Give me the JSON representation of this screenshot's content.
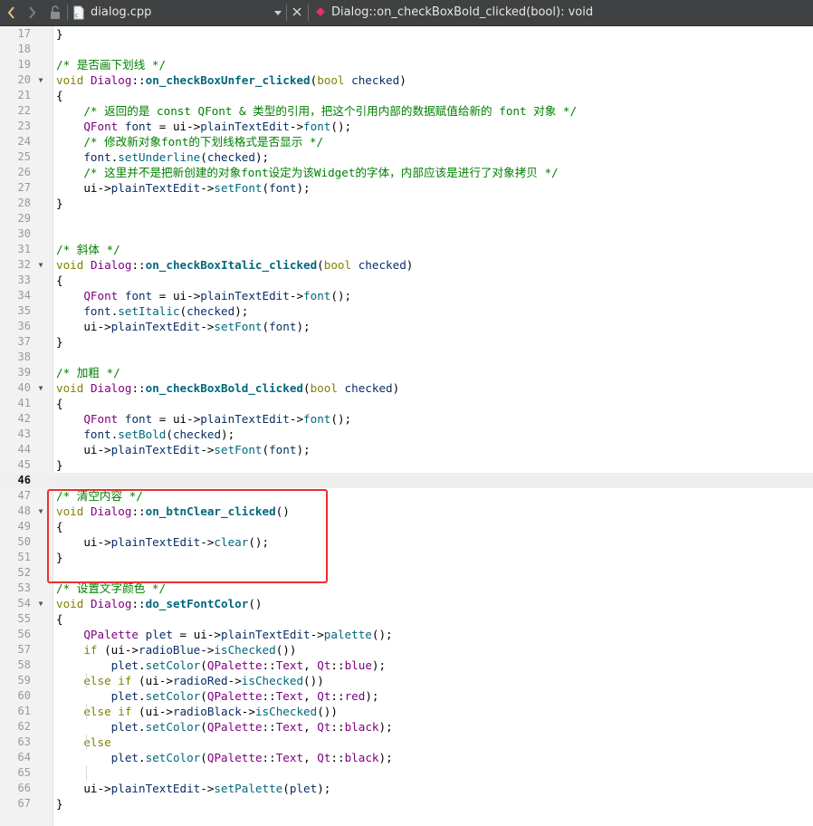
{
  "toolbar": {
    "back_icon": "chevron-left-icon",
    "forward_icon": "chevron-right-icon",
    "lock_icon": "lock-icon",
    "file_icon": "cpp-file-icon",
    "filename": "dialog.cpp",
    "dropdown_icon": "triangle-down-icon",
    "close_icon": "close-icon",
    "symbol_icon": "function-symbol-icon",
    "symbol": "Dialog::on_checkBoxBold_clicked(bool): void",
    "accent_color": "#e5c07b",
    "symbol_icon_color": "#e0316b"
  },
  "editor": {
    "current_line": 46,
    "highlight_color": "#ea2f2f",
    "lines": [
      {
        "n": "17",
        "t": "}",
        "fold": ""
      },
      {
        "n": "18",
        "t": "",
        "fold": ""
      },
      {
        "n": "19",
        "t": "/* 是否画下划线 */",
        "fold": ""
      },
      {
        "n": "20",
        "t": "void Dialog::on_checkBoxUnfer_clicked(bool checked)",
        "fold": "▼"
      },
      {
        "n": "21",
        "t": "{",
        "fold": ""
      },
      {
        "n": "22",
        "t": "    /* 返回的是 const QFont & 类型的引用，把这个引用内部的数据赋值给新的 font 对象 */",
        "fold": ""
      },
      {
        "n": "23",
        "t": "    QFont font = ui->plainTextEdit->font();",
        "fold": ""
      },
      {
        "n": "24",
        "t": "    /* 修改新对象font的下划线格式是否显示 */",
        "fold": ""
      },
      {
        "n": "25",
        "t": "    font.setUnderline(checked);",
        "fold": ""
      },
      {
        "n": "26",
        "t": "    /* 这里并不是把新创建的对象font设定为该Widget的字体，内部应该是进行了对象拷贝 */",
        "fold": ""
      },
      {
        "n": "27",
        "t": "    ui->plainTextEdit->setFont(font);",
        "fold": ""
      },
      {
        "n": "28",
        "t": "}",
        "fold": ""
      },
      {
        "n": "29",
        "t": "",
        "fold": ""
      },
      {
        "n": "30",
        "t": "",
        "fold": ""
      },
      {
        "n": "31",
        "t": "/* 斜体 */",
        "fold": ""
      },
      {
        "n": "32",
        "t": "void Dialog::on_checkBoxItalic_clicked(bool checked)",
        "fold": "▼"
      },
      {
        "n": "33",
        "t": "{",
        "fold": ""
      },
      {
        "n": "34",
        "t": "    QFont font = ui->plainTextEdit->font();",
        "fold": ""
      },
      {
        "n": "35",
        "t": "    font.setItalic(checked);",
        "fold": ""
      },
      {
        "n": "36",
        "t": "    ui->plainTextEdit->setFont(font);",
        "fold": ""
      },
      {
        "n": "37",
        "t": "}",
        "fold": ""
      },
      {
        "n": "38",
        "t": "",
        "fold": ""
      },
      {
        "n": "39",
        "t": "/* 加粗 */",
        "fold": ""
      },
      {
        "n": "40",
        "t": "void Dialog::on_checkBoxBold_clicked(bool checked)",
        "fold": "▼"
      },
      {
        "n": "41",
        "t": "{",
        "fold": ""
      },
      {
        "n": "42",
        "t": "    QFont font = ui->plainTextEdit->font();",
        "fold": ""
      },
      {
        "n": "43",
        "t": "    font.setBold(checked);",
        "fold": ""
      },
      {
        "n": "44",
        "t": "    ui->plainTextEdit->setFont(font);",
        "fold": ""
      },
      {
        "n": "45",
        "t": "}",
        "fold": ""
      },
      {
        "n": "46",
        "t": "",
        "fold": ""
      },
      {
        "n": "47",
        "t": "/* 清空内容 */",
        "fold": ""
      },
      {
        "n": "48",
        "t": "void Dialog::on_btnClear_clicked()",
        "fold": "▼"
      },
      {
        "n": "49",
        "t": "{",
        "fold": ""
      },
      {
        "n": "50",
        "t": "    ui->plainTextEdit->clear();",
        "fold": ""
      },
      {
        "n": "51",
        "t": "}",
        "fold": ""
      },
      {
        "n": "52",
        "t": "",
        "fold": ""
      },
      {
        "n": "53",
        "t": "/* 设置文字颜色 */",
        "fold": ""
      },
      {
        "n": "54",
        "t": "void Dialog::do_setFontColor()",
        "fold": "▼"
      },
      {
        "n": "55",
        "t": "{",
        "fold": ""
      },
      {
        "n": "56",
        "t": "    QPalette plet = ui->plainTextEdit->palette();",
        "fold": ""
      },
      {
        "n": "57",
        "t": "    if (ui->radioBlue->isChecked())",
        "fold": ""
      },
      {
        "n": "58",
        "t": "        plet.setColor(QPalette::Text, Qt::blue);",
        "fold": ""
      },
      {
        "n": "59",
        "t": "    else if (ui->radioRed->isChecked())",
        "fold": ""
      },
      {
        "n": "60",
        "t": "        plet.setColor(QPalette::Text, Qt::red);",
        "fold": ""
      },
      {
        "n": "61",
        "t": "    else if (ui->radioBlack->isChecked())",
        "fold": ""
      },
      {
        "n": "62",
        "t": "        plet.setColor(QPalette::Text, Qt::black);",
        "fold": ""
      },
      {
        "n": "63",
        "t": "    else",
        "fold": ""
      },
      {
        "n": "64",
        "t": "        plet.setColor(QPalette::Text, Qt::black);",
        "fold": ""
      },
      {
        "n": "65",
        "t": "",
        "fold": ""
      },
      {
        "n": "66",
        "t": "    ui->plainTextEdit->setPalette(plet);",
        "fold": ""
      },
      {
        "n": "67",
        "t": "}",
        "fold": ""
      }
    ]
  }
}
